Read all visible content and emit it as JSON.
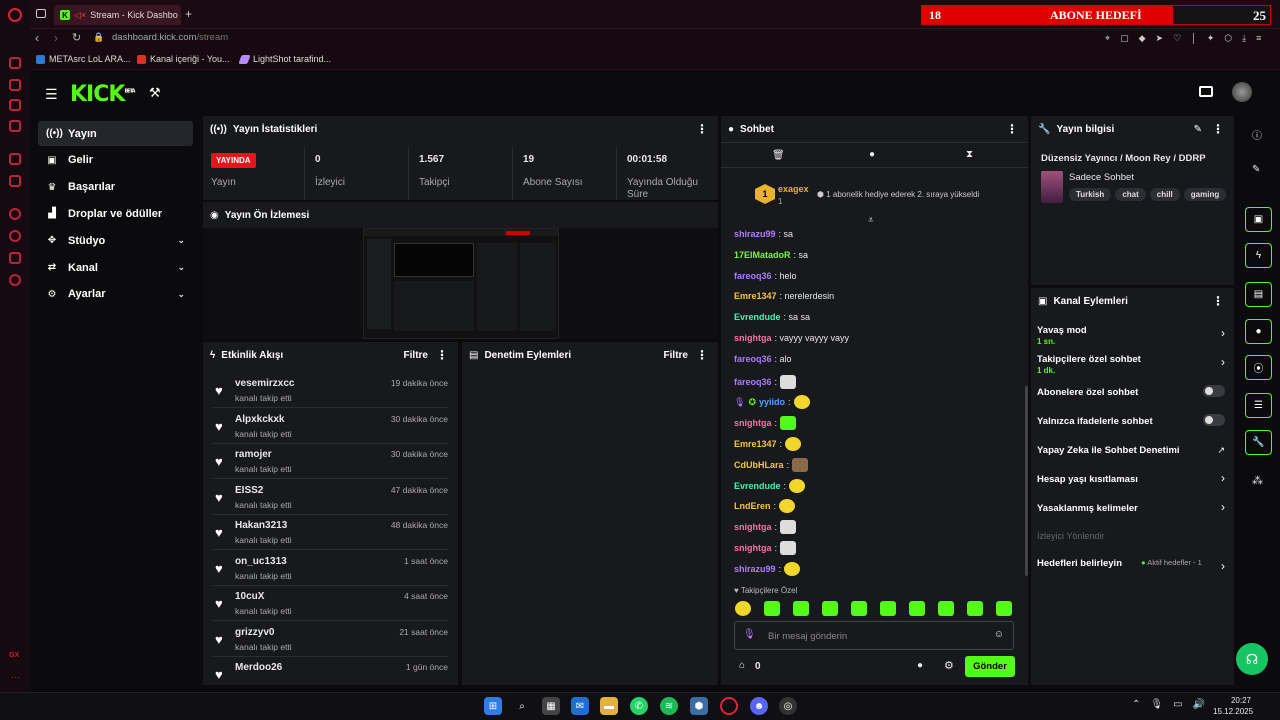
{
  "browser": {
    "tab_title": "Stream - Kick Dashbo",
    "url_host": "dashboard.kick.com",
    "url_path": "/stream",
    "bookmarks": [
      "METAsrc LoL ARA...",
      "Kanal içeriği - You...",
      "LightShot tarafind..."
    ]
  },
  "goal_widget": {
    "left_number": "18",
    "title": "ABONE HEDEFİ",
    "right_number": "25",
    "progress": 0.72
  },
  "sidebar": {
    "items": [
      {
        "label": "Yayın",
        "icon": "broadcast-icon",
        "active": true
      },
      {
        "label": "Gelir",
        "icon": "revenue-icon"
      },
      {
        "label": "Başarılar",
        "icon": "trophy-icon"
      },
      {
        "label": "Droplar ve ödüller",
        "icon": "drops-icon"
      },
      {
        "label": "Stüdyo",
        "icon": "studio-icon",
        "expandable": true
      },
      {
        "label": "Kanal",
        "icon": "channel-icon",
        "expandable": true
      },
      {
        "label": "Ayarlar",
        "icon": "gear-icon",
        "expandable": true
      }
    ]
  },
  "stats": {
    "title": "Yayın İstatistikleri",
    "live_badge": "YAYINDA",
    "items": [
      {
        "value": "",
        "label": "Yayın"
      },
      {
        "value": "0",
        "label": "İzleyici"
      },
      {
        "value": "1.567",
        "label": "Takipçi"
      },
      {
        "value": "19",
        "label": "Abone Sayısı"
      },
      {
        "value": "00:01:58",
        "label": "Yayında Olduğu Süre"
      }
    ]
  },
  "preview": {
    "title": "Yayın Ön İzlemesi"
  },
  "activity": {
    "title": "Etkinlik Akışı",
    "filter": "Filtre",
    "items": [
      {
        "name": "vesemirzxcc",
        "desc": "kanalı takip etti",
        "time": "19 dakika önce"
      },
      {
        "name": "Alpxkckxk",
        "desc": "kanalı takip etti",
        "time": "30 dakika önce"
      },
      {
        "name": "ramojer",
        "desc": "kanalı takip etti",
        "time": "30 dakika önce"
      },
      {
        "name": "EISS2",
        "desc": "kanalı takip etti",
        "time": "47 dakika önce"
      },
      {
        "name": "Hakan3213",
        "desc": "kanalı takip etti",
        "time": "48 dakika önce"
      },
      {
        "name": "on_uc1313",
        "desc": "kanalı takip etti",
        "time": "1 saat önce"
      },
      {
        "name": "10cuX",
        "desc": "kanalı takip etti",
        "time": "4 saat önce"
      },
      {
        "name": "grizzyv0",
        "desc": "kanalı takip etti",
        "time": "21 saat önce"
      },
      {
        "name": "Merdoo26",
        "desc": "",
        "time": "1 gün önce"
      }
    ]
  },
  "moderation": {
    "title": "Denetim Eylemleri",
    "filter": "Filtre"
  },
  "chat": {
    "title": "Sohbet",
    "gifter": "exagex",
    "gifter_count": "1",
    "gift_text": "1 abonelik hediye ederek 2. sıraya yükseldi",
    "messages": [
      {
        "user": "shirazu99",
        "color": "#b27cff",
        "text": ": sa"
      },
      {
        "user": "17ElMatadoR",
        "color": "#7cf542",
        "text": ": sa"
      },
      {
        "user": "fareoq36",
        "color": "#a87cff",
        "text": ": helo"
      },
      {
        "user": "Emre1347",
        "color": "#f5c542",
        "text": ": nerelerdesin"
      },
      {
        "user": "Evrendude",
        "color": "#42f5b0",
        "text": ": sa sa"
      },
      {
        "user": "snightga",
        "color": "#ff6fa0",
        "text": ": vayyy vayyy vayy"
      },
      {
        "user": "fareoq36",
        "color": "#a87cff",
        "text": ": alo"
      },
      {
        "user": "fareoq36",
        "color": "#a87cff",
        "text": ":",
        "emote": "w"
      },
      {
        "user": "yyiido",
        "color": "#53a0ff",
        "text": ":",
        "emote": "y"
      },
      {
        "user": "snightga",
        "color": "#ff6fa0",
        "text": ":",
        "emote": "g"
      },
      {
        "user": "Emre1347",
        "color": "#f5c542",
        "text": ":",
        "emote": "y"
      },
      {
        "user": "CdUbHLara",
        "color": "#f5c542",
        "text": ":",
        "emote": "b"
      },
      {
        "user": "Evrendude",
        "color": "#42f5b0",
        "text": ":",
        "emote": "y"
      },
      {
        "user": "LndEren",
        "color": "#f5c542",
        "text": ":",
        "emote": "y"
      },
      {
        "user": "snightga",
        "color": "#ff6fa0",
        "text": ":",
        "emote": "w"
      },
      {
        "user": "snightga",
        "color": "#ff6fa0",
        "text": ":",
        "emote": "w"
      },
      {
        "user": "shirazu99",
        "color": "#b27cff",
        "text": ":",
        "emote": "y"
      }
    ],
    "followers_only": "Takipçilere Özel",
    "placeholder": "Bir mesaj gönderin",
    "send": "Gönder",
    "points": "0"
  },
  "stream_info": {
    "title": "Yayın bilgisi",
    "stream_title": "Düzensiz Yayıncı / Moon Rey / DDRP",
    "category": "Sadece Sohbet",
    "tags": [
      "Turkish",
      "chat",
      "chill",
      "gaming"
    ]
  },
  "channel_actions": {
    "title": "Kanal Eylemleri",
    "items": [
      {
        "label": "Yavaş mod",
        "sub": "1 sn.",
        "kind": "arrow"
      },
      {
        "label": "Takipçilere özel sohbet",
        "sub": "1 dk.",
        "kind": "arrow"
      },
      {
        "label": "Abonelere özel sohbet",
        "sub": "",
        "kind": "toggle"
      },
      {
        "label": "Yalnızca ifadelerle sohbet",
        "sub": "",
        "kind": "toggle"
      },
      {
        "label": "Yapay Zeka ile Sohbet Denetimi",
        "sub": "",
        "kind": "external"
      },
      {
        "label": "Hesap yaşı kısıtlaması",
        "sub": "",
        "kind": "arrow"
      },
      {
        "label": "Yasaklanmış kelimeler",
        "sub": "",
        "kind": "arrow"
      }
    ],
    "section": "İzleyici Yönlendir",
    "goal_label": "Hedefleri belirleyin",
    "goal_status": "Aktif hedefler - 1"
  },
  "taskbar": {
    "time": "20:27",
    "date": "15.12.2025"
  },
  "colors": {
    "accent": "#53fc18",
    "live": "#e6151b",
    "panel": "#18191c"
  }
}
